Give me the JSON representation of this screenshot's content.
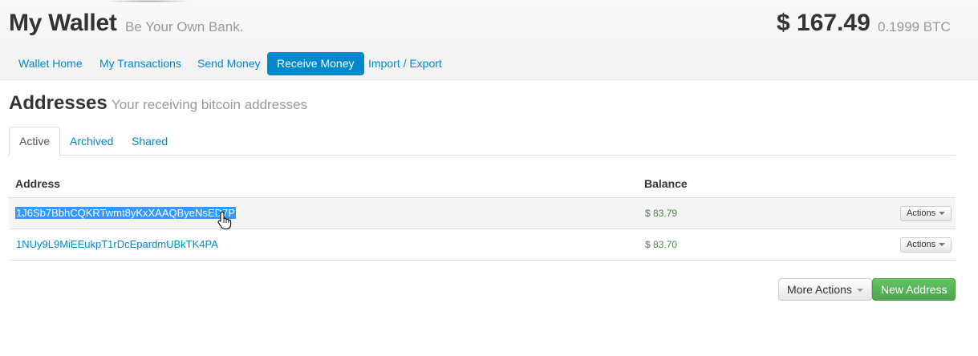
{
  "header": {
    "title": "My Wallet",
    "subtitle": "Be Your Own Bank.",
    "balance_usd": "$ 167.49",
    "balance_btc": "0.1999 BTC"
  },
  "nav": {
    "items": [
      {
        "label": "Wallet Home",
        "active": false
      },
      {
        "label": "My Transactions",
        "active": false
      },
      {
        "label": "Send Money",
        "active": false
      },
      {
        "label": "Receive Money",
        "active": true
      },
      {
        "label": "Import / Export",
        "active": false
      }
    ]
  },
  "section": {
    "title": "Addresses",
    "subtitle": "Your receiving bitcoin addresses"
  },
  "tabs": [
    {
      "label": "Active",
      "active": true
    },
    {
      "label": "Archived",
      "active": false
    },
    {
      "label": "Shared",
      "active": false
    }
  ],
  "table": {
    "columns": [
      "Address",
      "Balance"
    ],
    "rows": [
      {
        "address": "1J6Sb7BbhCQKRTwmt8yKxXAAQByeNsED7P",
        "balance": "$ 83.79",
        "actions_label": "Actions",
        "selected": true
      },
      {
        "address": "1NUy9L9MiEEukpT1rDcEpardmUBkTK4PA",
        "balance": "$ 83.70",
        "actions_label": "Actions",
        "selected": false
      }
    ]
  },
  "footer_buttons": {
    "more_actions": "More Actions",
    "new_address": "New Address"
  },
  "icons": {
    "cursor": "hand-pointer-icon",
    "dropdown": "caret-down-icon"
  },
  "colors": {
    "link": "#0088cc",
    "nav_active_bg": "#0088cc",
    "balance_green": "#468847",
    "new_address_green": "#5bb75b",
    "selection": "#3399ff"
  }
}
